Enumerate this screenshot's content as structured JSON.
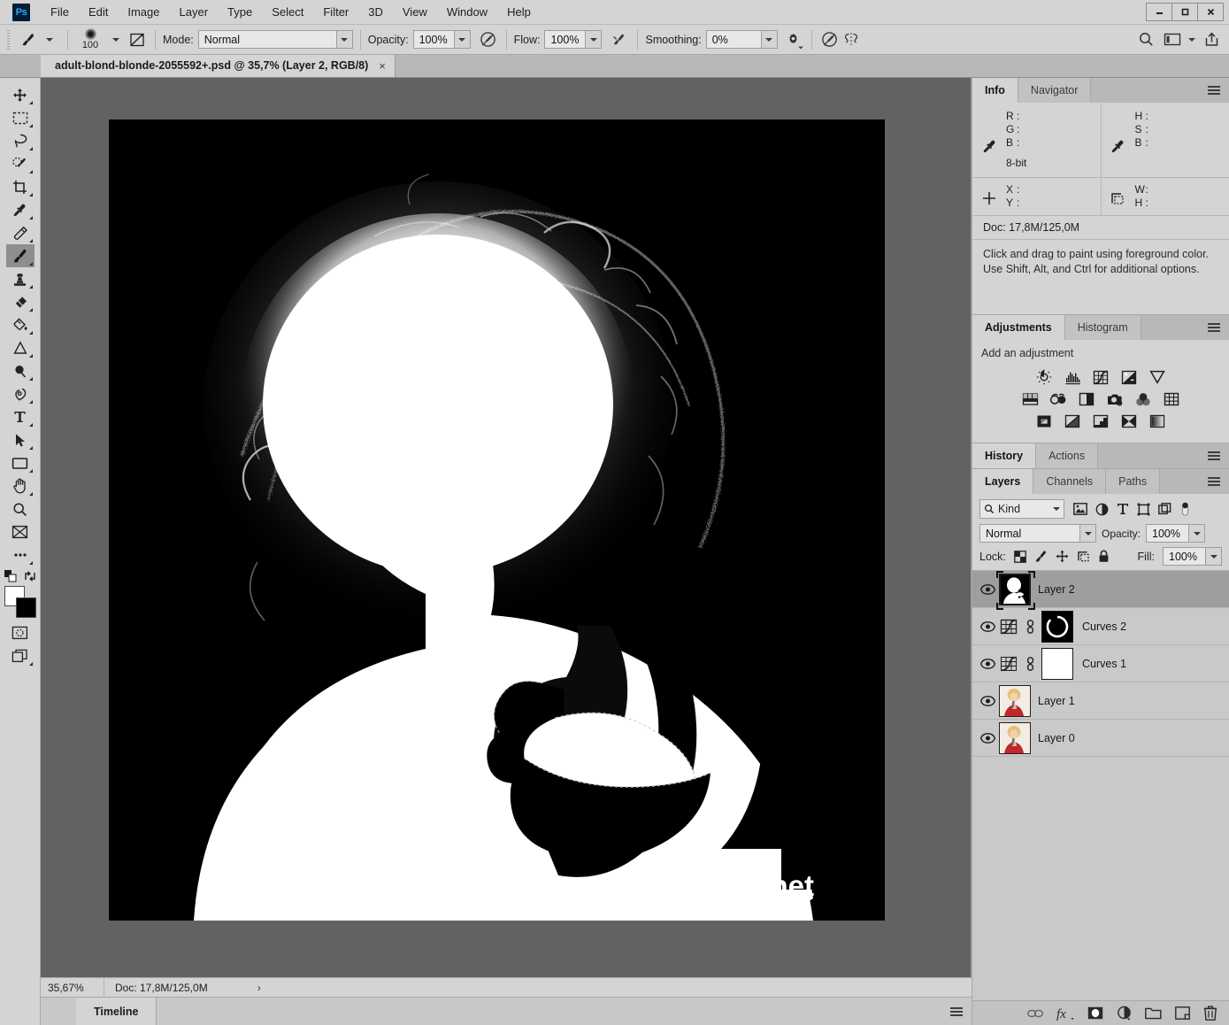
{
  "app": {
    "logo": "Ps"
  },
  "menu": {
    "items": [
      "File",
      "Edit",
      "Image",
      "Layer",
      "Type",
      "Select",
      "Filter",
      "3D",
      "View",
      "Window",
      "Help"
    ]
  },
  "window_controls": {
    "minimize": "–",
    "maximize": "□",
    "close": "✕"
  },
  "options_bar": {
    "brush_size": "100",
    "mode_label": "Mode:",
    "mode_value": "Normal",
    "opacity_label": "Opacity:",
    "opacity_value": "100%",
    "flow_label": "Flow:",
    "flow_value": "100%",
    "smoothing_label": "Smoothing:",
    "smoothing_value": "0%"
  },
  "document_tab": {
    "title": "adult-blond-blonde-2055592+.psd @ 35,7% (Layer 2, RGB/8)",
    "close": "×"
  },
  "canvas": {
    "watermark": "www.yakymchuk.net",
    "backdrop_color": "#626262",
    "artboard_bg": "#000000"
  },
  "status_bar": {
    "zoom": "35,67%",
    "doc": "Doc: 17,8M/125,0M",
    "arrow": "›"
  },
  "timeline": {
    "tab": "Timeline"
  },
  "info_panel": {
    "tabs": [
      "Info",
      "Navigator"
    ],
    "active_tab": "Info",
    "rgb": [
      {
        "label": "R",
        "sep": ":",
        "value": ""
      },
      {
        "label": "G",
        "sep": ":",
        "value": ""
      },
      {
        "label": "B",
        "sep": ":",
        "value": ""
      }
    ],
    "hsb": [
      {
        "label": "H",
        "sep": ":",
        "value": ""
      },
      {
        "label": "S",
        "sep": ":",
        "value": ""
      },
      {
        "label": "B",
        "sep": ":",
        "value": ""
      }
    ],
    "depth": "8-bit",
    "xy": [
      {
        "label": "X",
        "sep": ":",
        "value": ""
      },
      {
        "label": "Y",
        "sep": ":",
        "value": ""
      }
    ],
    "wh": [
      {
        "label": "W",
        "sep": ":",
        "value": ""
      },
      {
        "label": "H",
        "sep": ":",
        "value": ""
      }
    ],
    "doc": "Doc: 17,8M/125,0M",
    "hint_line1": "Click and drag to paint using foreground color.",
    "hint_line2": "Use Shift, Alt, and Ctrl for additional options."
  },
  "adjustments_panel": {
    "tabs": [
      "Adjustments",
      "Histogram"
    ],
    "active_tab": "Adjustments",
    "title": "Add an adjustment",
    "row1": [
      "brightness-contrast-icon",
      "levels-icon",
      "curves-icon",
      "exposure-icon",
      "vibrance-icon"
    ],
    "row2": [
      "hue-saturation-icon",
      "color-balance-icon",
      "black-white-icon",
      "photo-filter-icon",
      "channel-mixer-icon",
      "color-lookup-icon"
    ],
    "row3": [
      "invert-icon",
      "posterize-icon",
      "threshold-icon",
      "gradient-map-icon",
      "selective-color-icon"
    ]
  },
  "history_panel": {
    "tabs": [
      "History",
      "Actions"
    ],
    "active_tab": "History"
  },
  "layers_panel": {
    "tabs": [
      "Layers",
      "Channels",
      "Paths"
    ],
    "active_tab": "Layers",
    "filter_kind": "Kind",
    "filter_icons": [
      "pixel-filter-icon",
      "adjustment-filter-icon",
      "type-filter-icon",
      "shape-filter-icon",
      "smart-object-filter-icon",
      "filter-toggle-icon"
    ],
    "blend_mode": "Normal",
    "opacity_label": "Opacity:",
    "opacity_value": "100%",
    "lock_label": "Lock:",
    "lock_icons": [
      "lock-transparency-icon",
      "lock-image-icon",
      "lock-position-icon",
      "lock-artboard-icon",
      "lock-all-icon"
    ],
    "fill_label": "Fill:",
    "fill_value": "100%",
    "layers": [
      {
        "name": "Layer 2",
        "type": "pixel",
        "selected": true,
        "visible": true,
        "thumb": "silhouette"
      },
      {
        "name": "Curves 2",
        "type": "adjustment",
        "selected": false,
        "visible": true,
        "mask": "black"
      },
      {
        "name": "Curves 1",
        "type": "adjustment",
        "selected": false,
        "visible": true,
        "mask": "white"
      },
      {
        "name": "Layer 1",
        "type": "pixel",
        "selected": false,
        "visible": true,
        "thumb": "portrait"
      },
      {
        "name": "Layer 0",
        "type": "pixel",
        "selected": false,
        "visible": true,
        "thumb": "portrait"
      }
    ],
    "bottom_icons": [
      "link-layers-icon",
      "fx-icon",
      "add-mask-icon",
      "new-adjustment-icon",
      "new-group-icon",
      "new-layer-icon",
      "delete-layer-icon"
    ]
  },
  "toolbar": {
    "tools": [
      "move-tool",
      "rectangular-marquee-tool",
      "lasso-tool",
      "quick-selection-tool",
      "crop-tool",
      "eyedropper-tool",
      "healing-brush-tool",
      "brush-tool",
      "clone-stamp-tool",
      "eraser-tool",
      "paint-bucket-tool",
      "dodge-tool",
      "blur-tool",
      "pen-tool",
      "type-tool",
      "path-selection-tool",
      "rectangle-tool",
      "hand-tool",
      "zoom-tool",
      "frame-tool",
      "more-tools"
    ],
    "active_tool": "brush-tool",
    "foreground_color": "#ffffff",
    "background_color": "#000000"
  },
  "top_right_icons": [
    "search-icon",
    "workspace-icon",
    "share-icon"
  ]
}
